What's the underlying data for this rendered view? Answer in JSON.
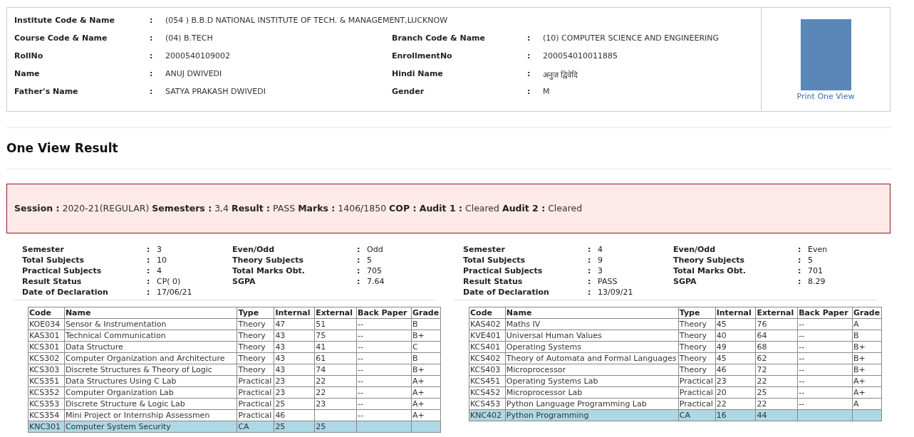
{
  "student": {
    "rows": [
      [
        {
          "label": "Institute Code & Name",
          "value": "(054 ) B.B.D NATIONAL INSTITUTE OF TECH. & MANAGEMENT,LUCKNOW"
        }
      ],
      [
        {
          "label": "Course Code & Name",
          "value": "(04) B.TECH"
        },
        {
          "label": "Branch Code & Name",
          "value": "(10) COMPUTER SCIENCE AND ENGINEERING"
        }
      ],
      [
        {
          "label": "RollNo",
          "value": "2000540109002"
        },
        {
          "label": "EnrollmentNo",
          "value": "200054010011885"
        }
      ],
      [
        {
          "label": "Name",
          "value": "ANUJ DWIVEDI"
        },
        {
          "label": "Hindi Name",
          "value": "अनुज द्विवेदि"
        }
      ],
      [
        {
          "label": "Father's Name",
          "value": "SATYA PRAKASH DWIVEDI"
        },
        {
          "label": "Gender",
          "value": "M"
        }
      ]
    ],
    "separator": ":",
    "print_link": "Print One View"
  },
  "page_title": "One View Result",
  "summary": "**Session :** 2020-21(REGULAR) **Semesters :** 3,4 **Result :** PASS **Marks :** 1406/1850 **COP : Audit 1 :** Cleared **Audit 2 :** Cleared",
  "semesters": [
    {
      "separator": ":",
      "info": [
        {
          "label": "Semester",
          "value": "3"
        },
        {
          "label": "Even/Odd",
          "value": "Odd"
        },
        {
          "label": "Total Subjects",
          "value": "10"
        },
        {
          "label": "Theory Subjects",
          "value": "5"
        },
        {
          "label": "Practical Subjects",
          "value": "4"
        },
        {
          "label": "Total Marks Obt.",
          "value": "705"
        },
        {
          "label": "Result Status",
          "value": "CP( 0)"
        },
        {
          "label": "SGPA",
          "value": "7.64"
        },
        {
          "label": "Date of Declaration",
          "value": "17/06/21"
        }
      ],
      "columns": [
        "Code",
        "Name",
        "Type",
        "Internal",
        "External",
        "Back Paper",
        "Grade"
      ],
      "rows": [
        {
          "cells": [
            "KOE034",
            "Sensor & Instrumentation",
            "Theory",
            "47",
            "51",
            "--",
            "B"
          ],
          "highlighted": false
        },
        {
          "cells": [
            "KAS301",
            "Technical Communication",
            "Theory",
            "43",
            "75",
            "--",
            "B+"
          ],
          "highlighted": false
        },
        {
          "cells": [
            "KCS301",
            "Data Structure",
            "Theory",
            "43",
            "41",
            "--",
            "C"
          ],
          "highlighted": false
        },
        {
          "cells": [
            "KCS302",
            "Computer Organization and Architecture",
            "Theory",
            "43",
            "61",
            "--",
            "B"
          ],
          "highlighted": false
        },
        {
          "cells": [
            "KCS303",
            "Discrete Structures & Theory of Logic",
            "Theory",
            "43",
            "74",
            "--",
            "B+"
          ],
          "highlighted": false
        },
        {
          "cells": [
            "KCS351",
            "Data Structures Using C Lab",
            "Practical",
            "23",
            "22",
            "--",
            "A+"
          ],
          "highlighted": false
        },
        {
          "cells": [
            "KCS352",
            "Computer Organization Lab",
            "Practical",
            "23",
            "22",
            "--",
            "A+"
          ],
          "highlighted": false
        },
        {
          "cells": [
            "KCS353",
            "Discrete Structure & Logic Lab",
            "Practical",
            "25",
            "23",
            "--",
            "A+"
          ],
          "highlighted": false
        },
        {
          "cells": [
            "KCS354",
            "Mini Project or Internship Assessmen",
            "Practical",
            "46",
            "",
            "--",
            "A+"
          ],
          "highlighted": false
        },
        {
          "cells": [
            "KNC301",
            "Computer System Security",
            "CA",
            "25",
            "25",
            "",
            ""
          ],
          "highlighted": true
        }
      ]
    },
    {
      "separator": ":",
      "info": [
        {
          "label": "Semester",
          "value": "4"
        },
        {
          "label": "Even/Odd",
          "value": "Even"
        },
        {
          "label": "Total Subjects",
          "value": "9"
        },
        {
          "label": "Theory Subjects",
          "value": "5"
        },
        {
          "label": "Practical Subjects",
          "value": "3"
        },
        {
          "label": "Total Marks Obt.",
          "value": "701"
        },
        {
          "label": "Result Status",
          "value": "PASS"
        },
        {
          "label": "SGPA",
          "value": "8.29"
        },
        {
          "label": "Date of Declaration",
          "value": "13/09/21"
        }
      ],
      "columns": [
        "Code",
        "Name",
        "Type",
        "Internal",
        "External",
        "Back Paper",
        "Grade"
      ],
      "rows": [
        {
          "cells": [
            "KAS402",
            "Maths IV",
            "Theory",
            "45",
            "76",
            "--",
            "A"
          ],
          "highlighted": false
        },
        {
          "cells": [
            "KVE401",
            "Universal Human Values",
            "Theory",
            "40",
            "64",
            "--",
            "B"
          ],
          "highlighted": false
        },
        {
          "cells": [
            "KCS401",
            "Operating Systems",
            "Theory",
            "49",
            "68",
            "--",
            "B+"
          ],
          "highlighted": false
        },
        {
          "cells": [
            "KCS402",
            "Theory of Automata and Formal Languages",
            "Theory",
            "45",
            "62",
            "--",
            "B+"
          ],
          "highlighted": false
        },
        {
          "cells": [
            "KCS403",
            "Microprocessor",
            "Theory",
            "46",
            "72",
            "--",
            "B+"
          ],
          "highlighted": false
        },
        {
          "cells": [
            "KCS451",
            "Operating Systems Lab",
            "Practical",
            "23",
            "22",
            "--",
            "A+"
          ],
          "highlighted": false
        },
        {
          "cells": [
            "KCS452",
            "Microprocessor Lab",
            "Practical",
            "20",
            "25",
            "--",
            "A+"
          ],
          "highlighted": false
        },
        {
          "cells": [
            "KCS453",
            "Python Language Programming Lab",
            "Practical",
            "22",
            "22",
            "--",
            "A"
          ],
          "highlighted": false
        },
        {
          "cells": [
            "KNC402",
            "Python Programming",
            "CA",
            "16",
            "44",
            "",
            ""
          ],
          "highlighted": true
        }
      ]
    }
  ]
}
